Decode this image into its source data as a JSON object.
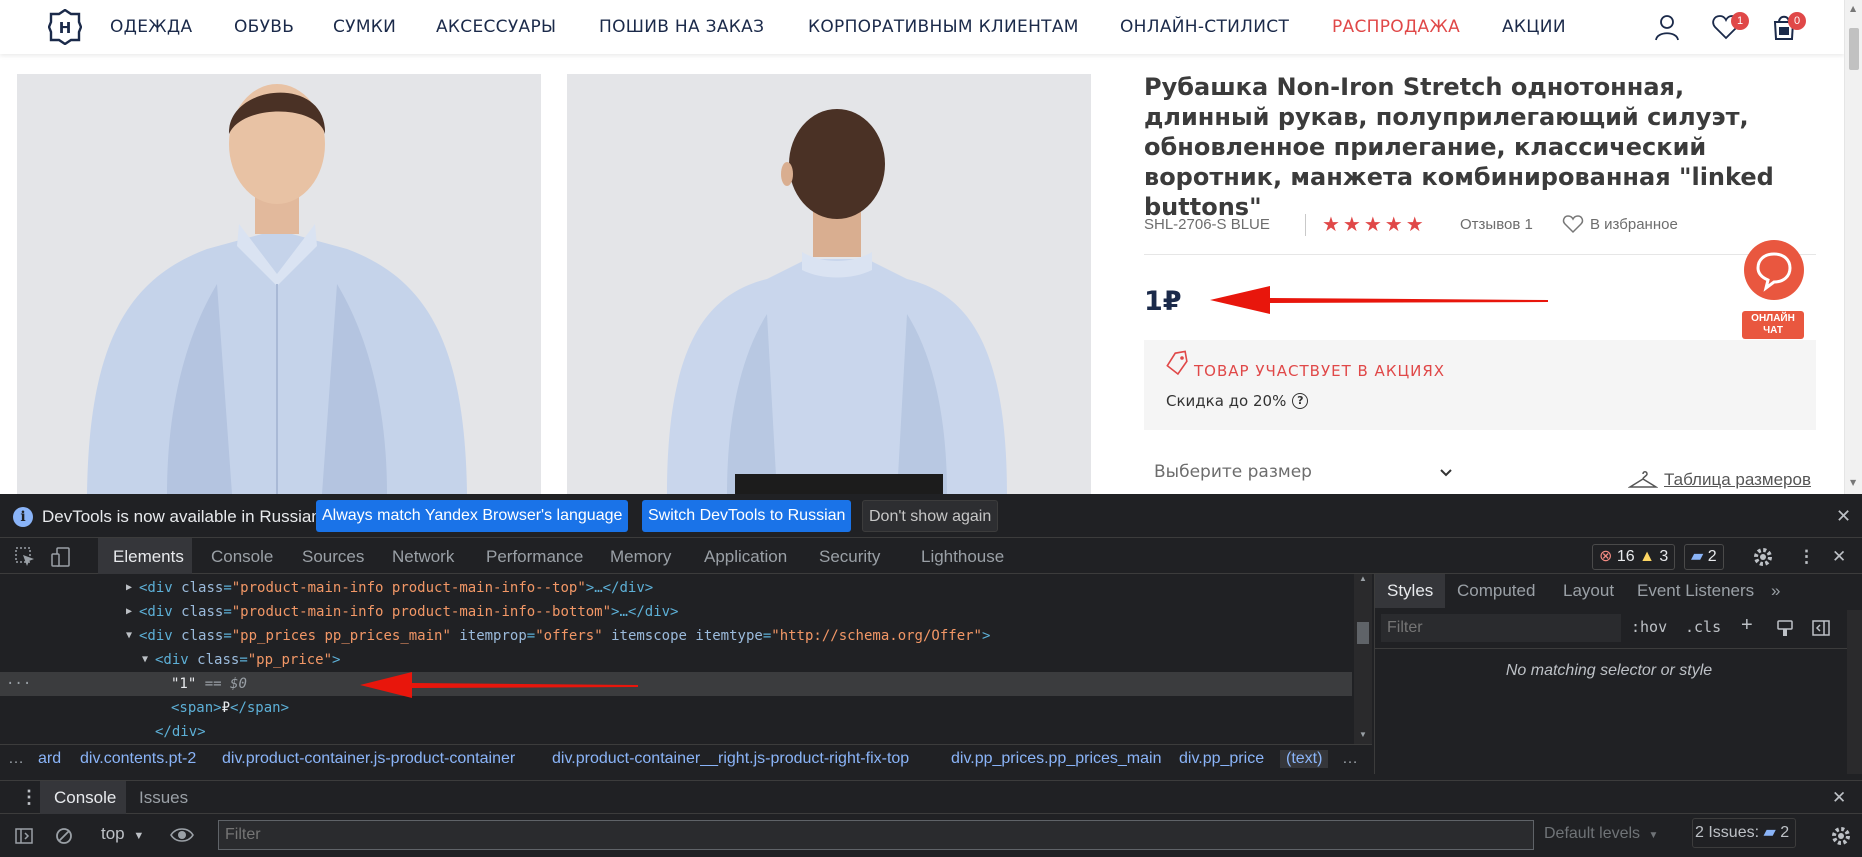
{
  "header": {
    "logo_letter": "Н",
    "nav": [
      {
        "label": "ОДЕЖДА"
      },
      {
        "label": "ОБУВЬ"
      },
      {
        "label": "СУМКИ"
      },
      {
        "label": "АКСЕССУАРЫ"
      },
      {
        "label": "ПОШИВ НА ЗАКАЗ"
      },
      {
        "label": "КОРПОРАТИВНЫМ КЛИЕНТАМ"
      },
      {
        "label": "ОНЛАЙН-СТИЛИСТ"
      },
      {
        "label": "РАСПРОДАЖА"
      },
      {
        "label": "АКЦИИ"
      }
    ],
    "icons": [
      "user-icon",
      "heart-icon",
      "cart-icon"
    ],
    "wishlist_count": "1",
    "cart_count": "0"
  },
  "product": {
    "title": "Рубашка Non-Iron Stretch однотонная, длинный рукав, полуприлегающий силуэт, обновленное прилегание, классический воротник, манжета комбинированная \"linked buttons\"",
    "sku": "SHL-2706-S BLUE",
    "rating_stars": "★★★★★",
    "rating": 5,
    "reviews": "Отзывов 1",
    "favorite_label": "В избранное",
    "price": "1₽",
    "promo_title": "ТОВАР УЧАСТВУЕТ В АКЦИЯХ",
    "promo_sub": "Скидка до 20%",
    "size_placeholder": "Выберите размер",
    "size_table": "Таблица размеров",
    "chat_label_1": "ОНЛАЙН",
    "chat_label_2": "ЧАТ"
  },
  "colors": {
    "brand_navy": "#1b2a4a",
    "sale_red": "#e04848",
    "devtools_bg": "#202124",
    "devtools_accent": "#1a73e8"
  },
  "devtools": {
    "infobar": {
      "text": "DevTools is now available in Russian!",
      "btn_match": "Always match Yandex Browser's language",
      "btn_switch": "Switch DevTools to Russian",
      "btn_dismiss": "Don't show again"
    },
    "tabs": [
      "Elements",
      "Console",
      "Sources",
      "Network",
      "Performance",
      "Memory",
      "Application",
      "Security",
      "Lighthouse"
    ],
    "errors": "16",
    "warnings": "3",
    "messages": "2",
    "code": {
      "l1_open": "<div",
      "l1_attr": "class",
      "l1_val": "\"product-main-info product-main-info--top\"",
      "l1_close": ">…</div>",
      "l2_open": "<div",
      "l2_attr": "class",
      "l2_val": "\"product-main-info product-main-info--bottom\"",
      "l2_close": ">…</div>",
      "l3_open": "<div",
      "l3_attr1": "class",
      "l3_val1": "\"pp_prices pp_prices_main\"",
      "l3_attr2": "itemprop",
      "l3_val2": "\"offers\"",
      "l3_attr3": "itemscope",
      "l3_attr4": "itemtype",
      "l3_val4": "\"http://schema.org/Offer\"",
      "l3_close": ">",
      "l4_open": "<div",
      "l4_attr": "class",
      "l4_val": "\"pp_price\"",
      "l4_close": ">",
      "l5_text": "\"1\"",
      "l5_suffix": "== $0",
      "l6_open": "<span>",
      "l6_text": "₽",
      "l6_close": "</span>",
      "l7": "</div>"
    },
    "breadcrumbs": [
      "ard",
      "div.contents.pt-2",
      "div.product-container.js-product-container",
      "div.product-container__right.js-product-right-fix-top",
      "div.pp_prices.pp_prices_main",
      "div.pp_price",
      "(text)"
    ],
    "styles_tabs": [
      "Styles",
      "Computed",
      "Layout",
      "Event Listeners"
    ],
    "styles_more": "»",
    "styles_filter_placeholder": "Filter",
    "hov": ":hov",
    "cls": ".cls",
    "no_match": "No matching selector or style",
    "drawer_tabs": [
      "Console",
      "Issues"
    ],
    "console_context": "top",
    "console_filter_placeholder": "Filter",
    "default_levels": "Default levels",
    "issues_label": "2 Issues:",
    "issues_count": "2"
  }
}
